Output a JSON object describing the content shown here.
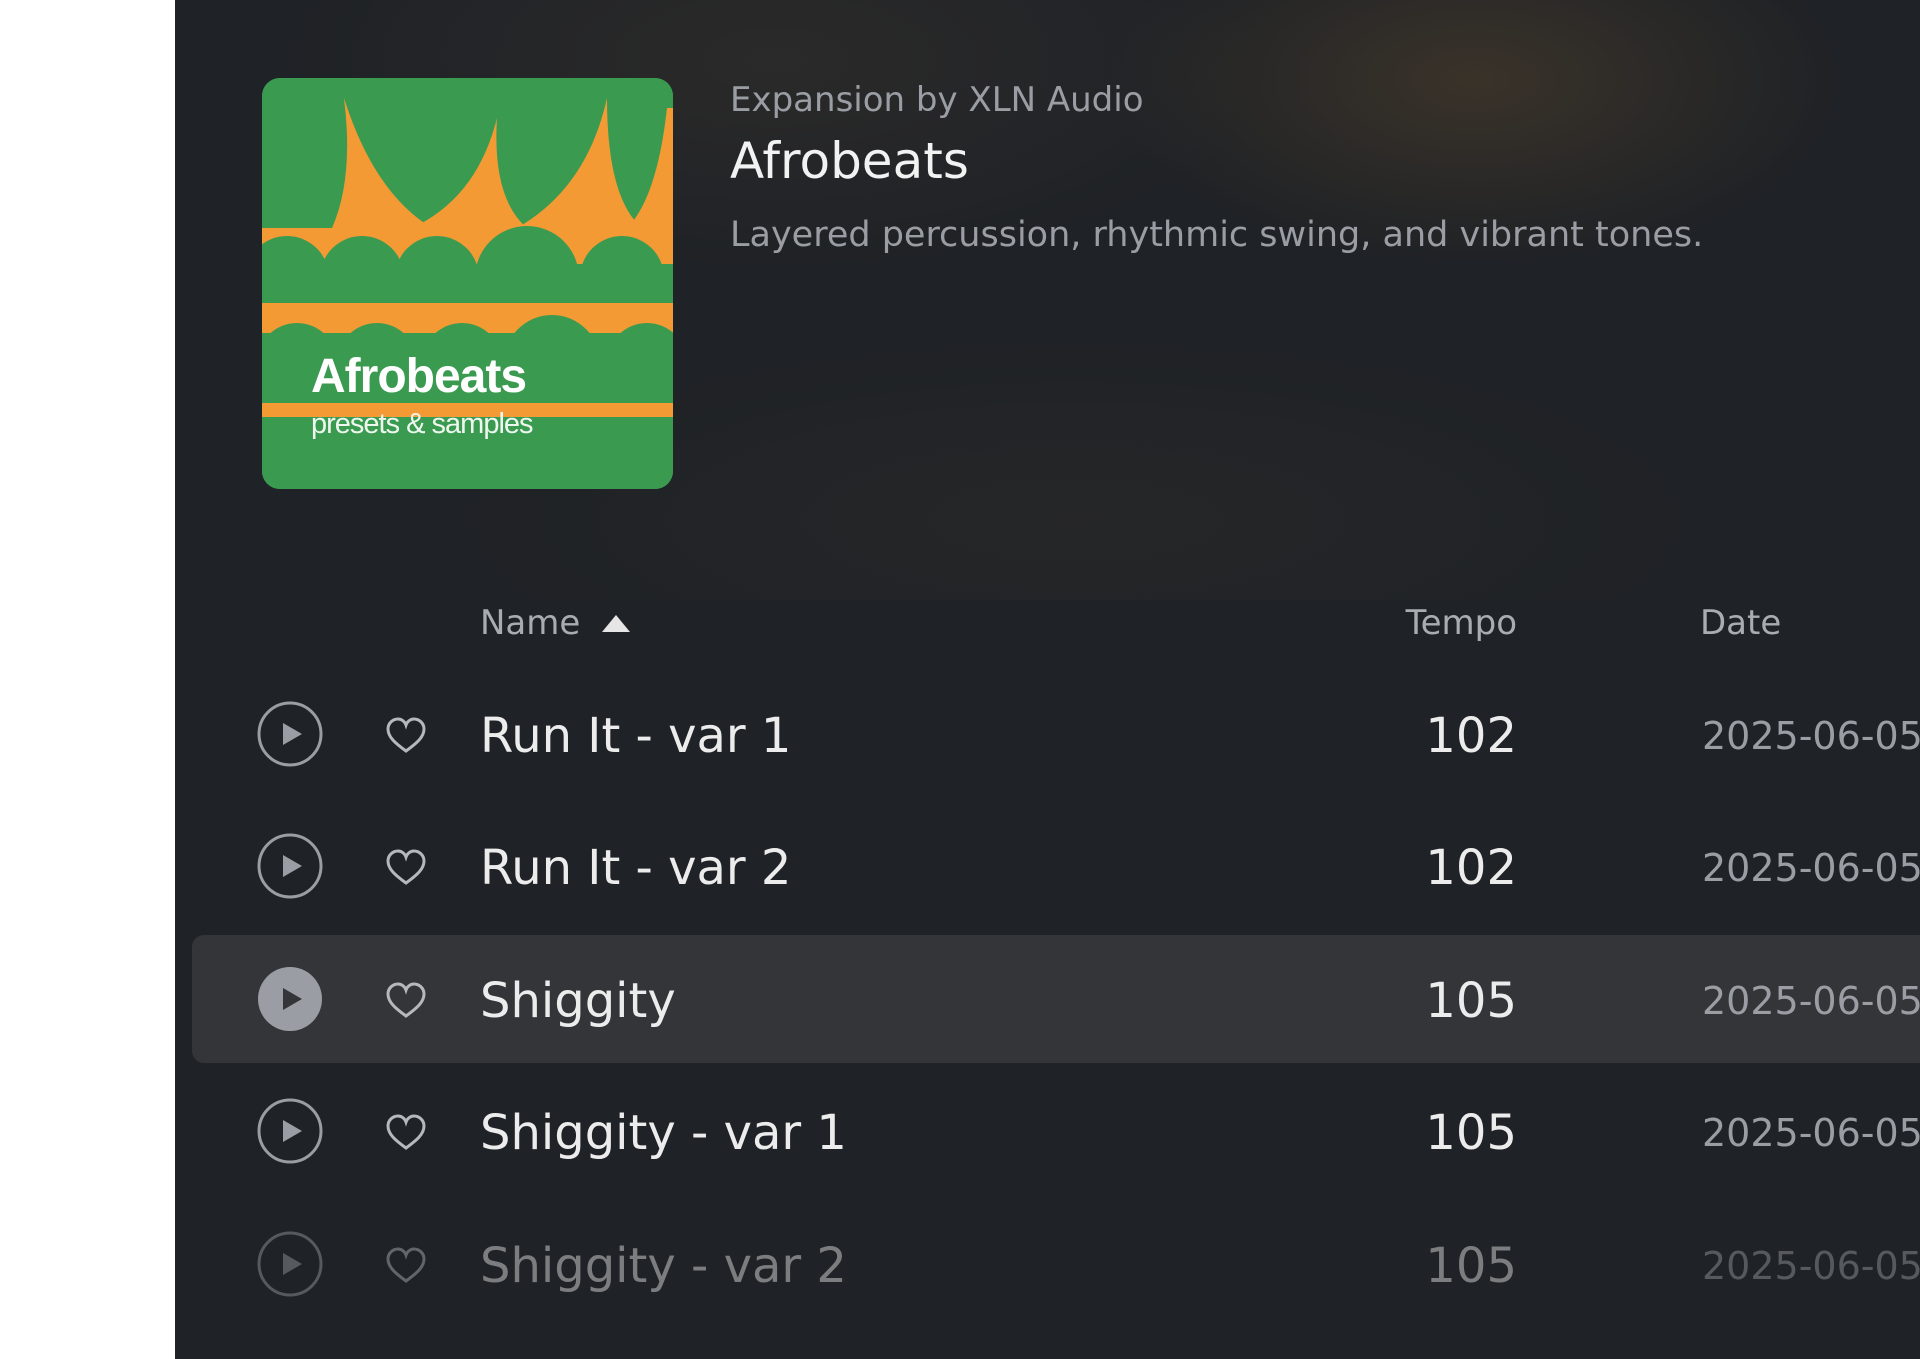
{
  "expansion": {
    "byline": "Expansion by XLN Audio",
    "title": "Afrobeats",
    "description": "Layered percussion, rhythmic swing, and vibrant tones.",
    "cover": {
      "title": "Afrobeats",
      "subtitle": "presets & samples",
      "colors": {
        "green": "#3a9a50",
        "orange": "#f39a35"
      }
    }
  },
  "table": {
    "headers": {
      "name": "Name",
      "tempo": "Tempo",
      "date": "Date"
    },
    "sort": {
      "column": "name",
      "direction": "ascending"
    },
    "rows": [
      {
        "name": "Run It - var 1",
        "tempo": "102",
        "date": "2025-06-05",
        "selected": false
      },
      {
        "name": "Run It - var 2",
        "tempo": "102",
        "date": "2025-06-05",
        "selected": false
      },
      {
        "name": "Shiggity",
        "tempo": "105",
        "date": "2025-06-05",
        "selected": true
      },
      {
        "name": "Shiggity - var 1",
        "tempo": "105",
        "date": "2025-06-05",
        "selected": false
      },
      {
        "name": "Shiggity - var 2",
        "tempo": "105",
        "date": "2025-06-05",
        "selected": false
      }
    ]
  },
  "icons": {
    "play": "play-icon",
    "favorite": "heart-icon",
    "sort": "sort-ascending-icon"
  },
  "colors": {
    "background": "#1f2226",
    "selected_row": "#343538",
    "text": "#ececec",
    "muted": "#9a9ea4"
  }
}
